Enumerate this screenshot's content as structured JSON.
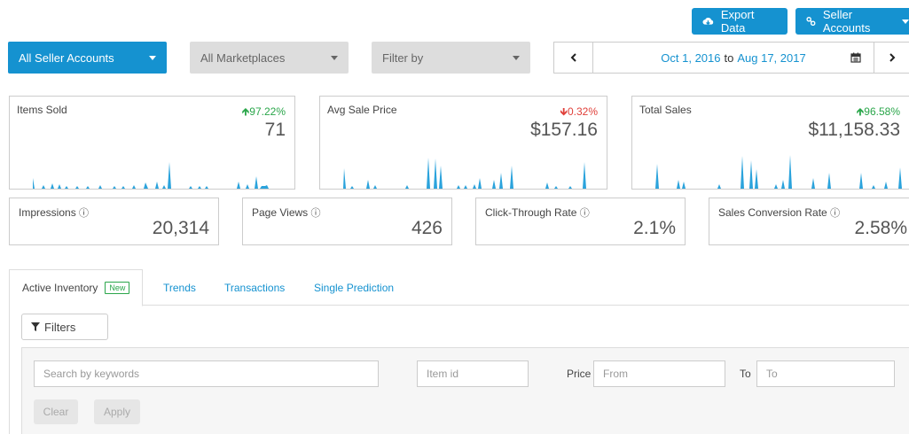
{
  "header": {
    "export_label": "Export Data",
    "seller_accounts_label": "Seller Accounts",
    "export_icon": "cloud-download-icon",
    "link_icon": "link-icon"
  },
  "filters_row": {
    "account_select": "All Seller Accounts",
    "marketplace_select": "All Marketplaces",
    "filter_by_select": "Filter by",
    "date_start": "Oct 1, 2016",
    "date_to": "to",
    "date_end": "Aug 17, 2017"
  },
  "stats": [
    {
      "label": "Items Sold",
      "change": "97.22%",
      "direction": "up",
      "value": "71"
    },
    {
      "label": "Avg Sale Price",
      "change": "0.32%",
      "direction": "down",
      "value": "$157.16"
    },
    {
      "label": "Total Sales",
      "change": "96.58%",
      "direction": "up",
      "value": "$11,158.33"
    }
  ],
  "metrics": [
    {
      "label": "Impressions",
      "value": "20,314"
    },
    {
      "label": "Page Views",
      "value": "426"
    },
    {
      "label": "Click-Through Rate",
      "value": "2.1%"
    },
    {
      "label": "Sales Conversion Rate",
      "value": "2.58%"
    }
  ],
  "tabs": {
    "active_inventory": "Active Inventory",
    "new_badge": "New",
    "trends": "Trends",
    "transactions": "Transactions",
    "single_prediction": "Single Prediction"
  },
  "search": {
    "filters_label": "Filters",
    "keywords_placeholder": "Search by keywords",
    "item_id_placeholder": "Item id",
    "price_label": "Price",
    "from_placeholder": "From",
    "to_label": "To",
    "to_placeholder": "To",
    "clear_label": "Clear",
    "apply_label": "Apply"
  },
  "colors": {
    "accent": "#1592d0",
    "up": "#2aa64a",
    "down": "#e0403a",
    "spark": "#2ba3dc"
  }
}
